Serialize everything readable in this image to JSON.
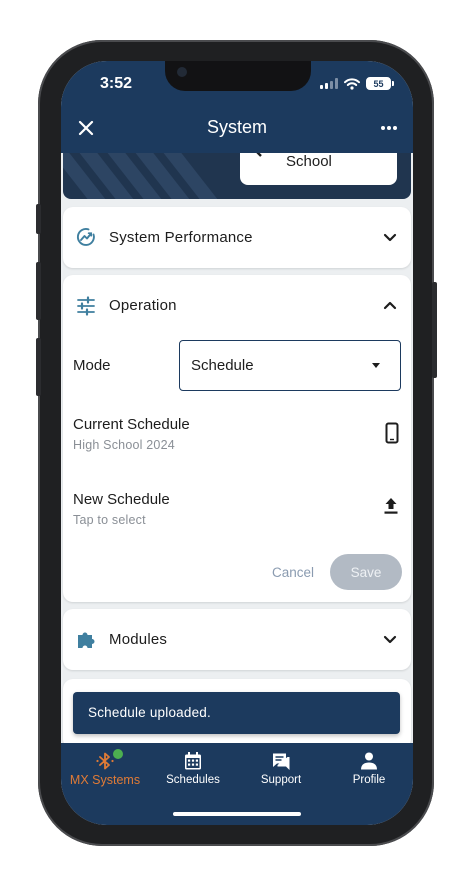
{
  "status_bar": {
    "time": "3:52",
    "battery": "55"
  },
  "header": {
    "title": "System"
  },
  "hero": {
    "school_name": "School"
  },
  "sections": {
    "system_performance": {
      "label": "System Performance"
    },
    "operation": {
      "label": "Operation",
      "mode_label": "Mode",
      "mode_value": "Schedule",
      "current_schedule_label": "Current Schedule",
      "current_schedule_value": "High School 2024",
      "new_schedule_label": "New Schedule",
      "new_schedule_hint": "Tap to select",
      "cancel_label": "Cancel",
      "save_label": "Save"
    },
    "modules": {
      "label": "Modules"
    }
  },
  "snackbar": {
    "message": "Schedule uploaded."
  },
  "bottom_nav": {
    "items": [
      {
        "label": "MX Systems",
        "icon": "bluetooth-icon",
        "active": true
      },
      {
        "label": "Schedules",
        "icon": "calendar-icon",
        "active": false
      },
      {
        "label": "Support",
        "icon": "chat-icon",
        "active": false
      },
      {
        "label": "Profile",
        "icon": "person-icon",
        "active": false
      }
    ]
  },
  "colors": {
    "primary": "#1c3a5e",
    "accent": "#e07b36",
    "icon_teal": "#3f7f9f",
    "status_online": "#4caf50",
    "save_disabled": "#b2bac4"
  }
}
